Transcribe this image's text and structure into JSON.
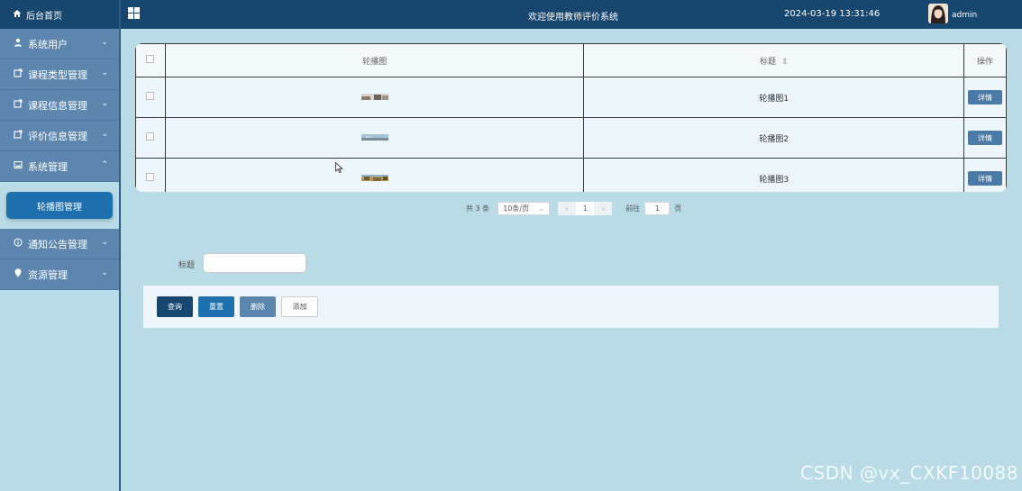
{
  "sidebar": {
    "home_label": "后台首页",
    "items": [
      {
        "label": "系统用户",
        "icon": "user-icon"
      },
      {
        "label": "课程类型管理",
        "icon": "external-icon"
      },
      {
        "label": "课程信息管理",
        "icon": "external-icon"
      },
      {
        "label": "评价信息管理",
        "icon": "external-icon"
      },
      {
        "label": "系统管理",
        "icon": "picture-icon"
      }
    ],
    "submenu_active": "轮播图管理",
    "items_after": [
      {
        "label": "通知公告管理",
        "icon": "info-icon"
      },
      {
        "label": "资源管理",
        "icon": "location-icon"
      }
    ]
  },
  "header": {
    "title": "欢迎使用教师评价系统",
    "datetime": "2024-03-19 13:31:46",
    "username": "admin"
  },
  "table": {
    "headers": {
      "image": "轮播图",
      "title": "标题",
      "actions": "操作"
    },
    "rows": [
      {
        "title": "轮播图1",
        "action": "详情"
      },
      {
        "title": "轮播图2",
        "action": "详情"
      },
      {
        "title": "轮播图3",
        "action": "详情"
      }
    ]
  },
  "pagination": {
    "total": "共 3 条",
    "page_size": "10条/页",
    "current": "1",
    "goto_prefix": "前往",
    "goto_value": "1",
    "goto_suffix": "页"
  },
  "search": {
    "label": "标题",
    "value": ""
  },
  "actions": {
    "query": "查询",
    "reset": "重置",
    "delete": "删除",
    "add": "添加"
  },
  "colors": {
    "nav_dark": "#17466f",
    "nav_item": "#5d86af",
    "background": "#b8dbe6",
    "primary": "#1e6fae"
  },
  "watermark": "CSDN @vx_CXKF10088"
}
